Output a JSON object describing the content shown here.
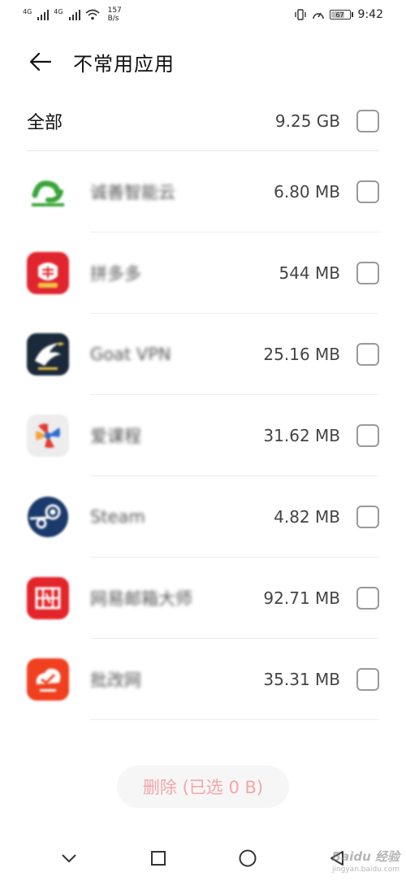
{
  "status_bar": {
    "signal_1_label": "4G",
    "signal_2_label": "4G",
    "speed_value": "157",
    "speed_unit": "B/s",
    "battery_level": "67",
    "time": "9:42"
  },
  "header": {
    "title": "不常用应用"
  },
  "all_row": {
    "label": "全部",
    "size": "9.25 GB"
  },
  "apps": [
    {
      "name": "诚善智能云",
      "size": "6.80 MB",
      "icon": "chengshan-cloud-icon",
      "color": "#3aa53a"
    },
    {
      "name": "拼多多",
      "size": "544 MB",
      "icon": "pinduoduo-icon",
      "color": "#e0252f"
    },
    {
      "name": "Goat VPN",
      "size": "25.16 MB",
      "icon": "goat-vpn-icon",
      "color": "#1b2a3a"
    },
    {
      "name": "爱课程",
      "size": "31.62 MB",
      "icon": "ai-kecheng-icon",
      "color": "#e23b2f"
    },
    {
      "name": "Steam",
      "size": "4.82 MB",
      "icon": "steam-icon",
      "color": "#1a3a6b"
    },
    {
      "name": "网易邮箱大师",
      "size": "92.71 MB",
      "icon": "netease-mail-master-icon",
      "color": "#e3252a"
    },
    {
      "name": "批改网",
      "size": "35.31 MB",
      "icon": "pigai-icon",
      "color": "#f0401f"
    }
  ],
  "delete_button": {
    "label": "删除 (已选 0 B)"
  },
  "watermark": {
    "text": "Baidu 经验",
    "sub": "jingyan.baidu.com"
  },
  "colors": {
    "delete_text": "#f3a6a6",
    "checkbox_border": "#9a9a9a"
  }
}
